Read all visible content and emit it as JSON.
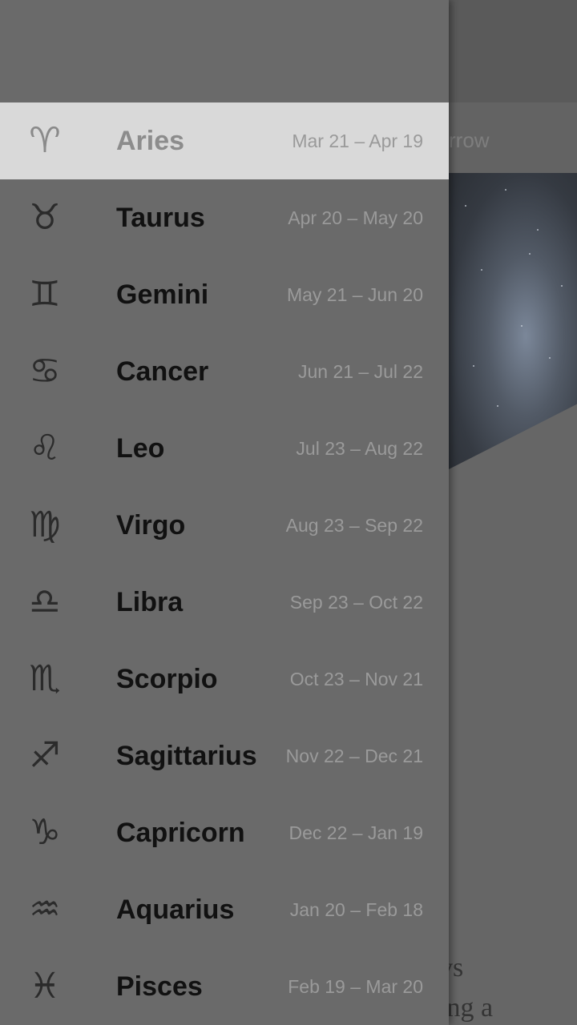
{
  "background": {
    "tab_partial": "rrow",
    "body_text_line1": "vs",
    "body_text_line2": "ing a"
  },
  "drawer": {
    "items": [
      {
        "icon": "♈",
        "name": "Aries",
        "dates": "Mar 21 – Apr 19",
        "selected": true
      },
      {
        "icon": "♉",
        "name": "Taurus",
        "dates": "Apr 20 – May 20",
        "selected": false
      },
      {
        "icon": "♊",
        "name": "Gemini",
        "dates": "May 21 – Jun 20",
        "selected": false
      },
      {
        "icon": "♋",
        "name": "Cancer",
        "dates": "Jun 21 – Jul 22",
        "selected": false
      },
      {
        "icon": "♌",
        "name": "Leo",
        "dates": "Jul 23 – Aug 22",
        "selected": false
      },
      {
        "icon": "♍",
        "name": "Virgo",
        "dates": "Aug 23 – Sep 22",
        "selected": false
      },
      {
        "icon": "♎",
        "name": "Libra",
        "dates": "Sep 23 – Oct 22",
        "selected": false
      },
      {
        "icon": "♏",
        "name": "Scorpio",
        "dates": "Oct 23 – Nov 21",
        "selected": false
      },
      {
        "icon": "♐",
        "name": "Sagittarius",
        "dates": "Nov 22 – Dec 21",
        "selected": false
      },
      {
        "icon": "♑",
        "name": "Capricorn",
        "dates": "Dec 22 – Jan 19",
        "selected": false
      },
      {
        "icon": "♒",
        "name": "Aquarius",
        "dates": "Jan 20 – Feb 18",
        "selected": false
      },
      {
        "icon": "♓",
        "name": "Pisces",
        "dates": "Feb 19 – Mar 20",
        "selected": false
      }
    ]
  },
  "colors": {
    "scrim": "#666666",
    "selected_row": "#d9d9d9",
    "drawer_bg": "#6a6a6a"
  }
}
